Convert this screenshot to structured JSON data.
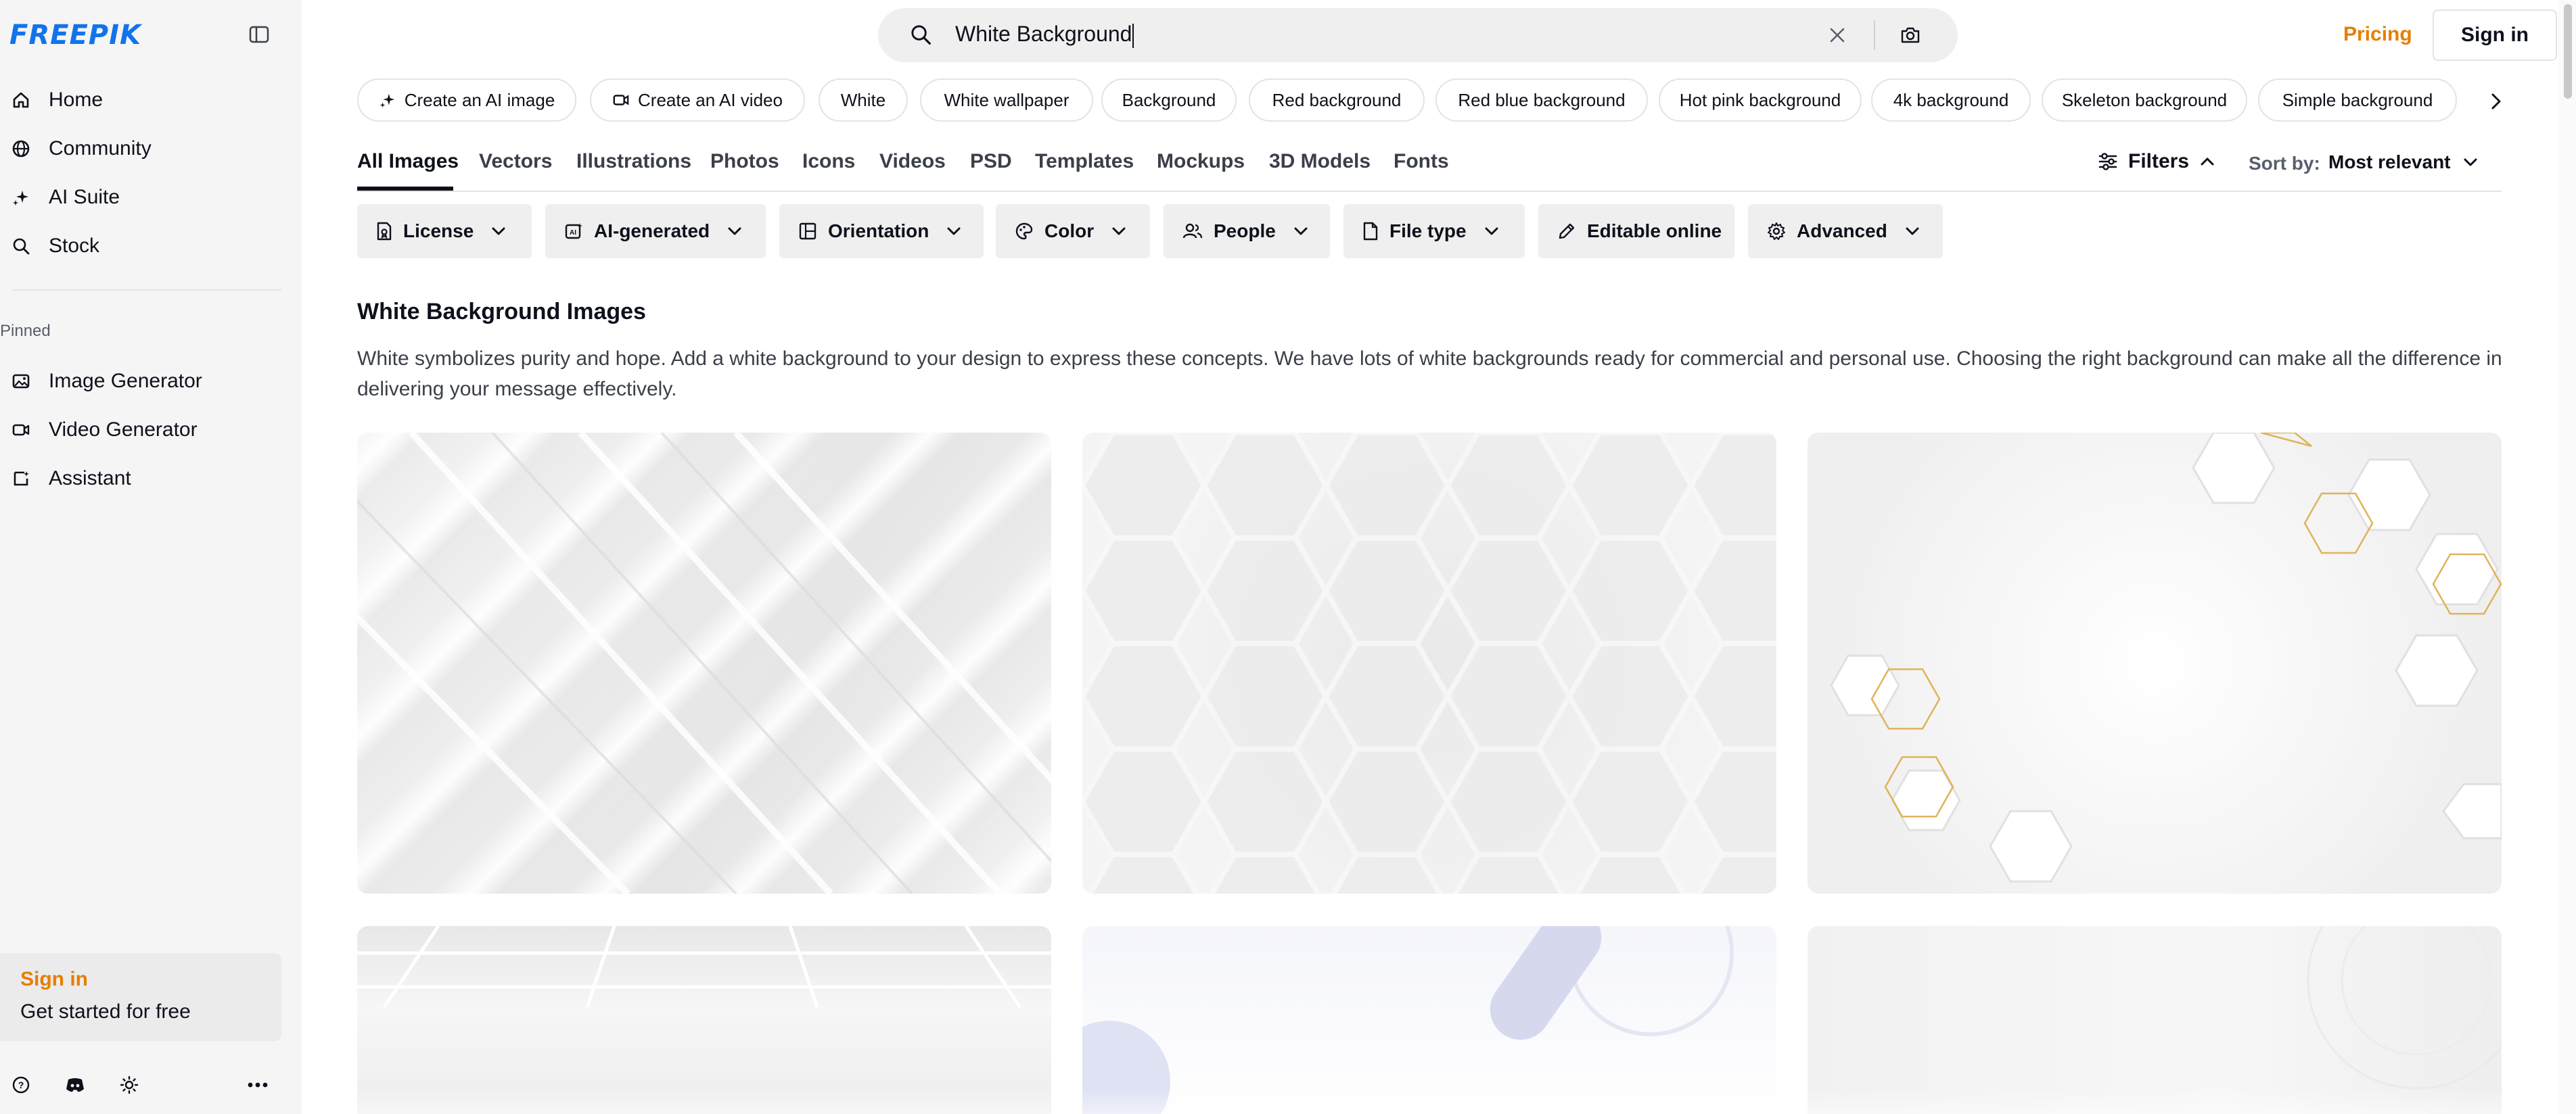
{
  "brand": {
    "logo_text": "FREEPIK",
    "accent": "#1273eb",
    "orange": "#e67e00"
  },
  "sidebar": {
    "nav": [
      {
        "label": "Home",
        "icon": "home-icon"
      },
      {
        "label": "Community",
        "icon": "globe-icon"
      },
      {
        "label": "AI Suite",
        "icon": "sparkle-icon"
      },
      {
        "label": "Stock",
        "icon": "search-icon"
      }
    ],
    "pinned_label": "Pinned",
    "pinned": [
      {
        "label": "Image Generator",
        "icon": "image-icon"
      },
      {
        "label": "Video Generator",
        "icon": "video-icon"
      },
      {
        "label": "Assistant",
        "icon": "assistant-icon"
      }
    ],
    "signin_card": {
      "title": "Sign in",
      "subtitle": "Get started for free"
    }
  },
  "header": {
    "search_value": "White Background",
    "pricing": "Pricing",
    "sign_in": "Sign in"
  },
  "chips": [
    "Create an AI image",
    "Create an AI video",
    "White",
    "White wallpaper",
    "Background",
    "Red background",
    "Red blue background",
    "Hot pink background",
    "4k background",
    "Skeleton background",
    "Simple background"
  ],
  "tabs": [
    "All Images",
    "Vectors",
    "Illustrations",
    "Photos",
    "Icons",
    "Videos",
    "PSD",
    "Templates",
    "Mockups",
    "3D Models",
    "Fonts"
  ],
  "toolbar": {
    "filters": "Filters",
    "sort_label": "Sort by:",
    "sort_value": "Most relevant"
  },
  "filters": [
    "License",
    "AI-generated",
    "Orientation",
    "Color",
    "People",
    "File type",
    "Editable online",
    "Advanced"
  ],
  "content": {
    "heading": "White Background Images",
    "description": "White symbolizes purity and hope. Add a white background to your design to express these concepts. We have lots of white backgrounds ready for commercial and personal use. Choosing the right background can make all the difference in delivering your message effectively."
  }
}
